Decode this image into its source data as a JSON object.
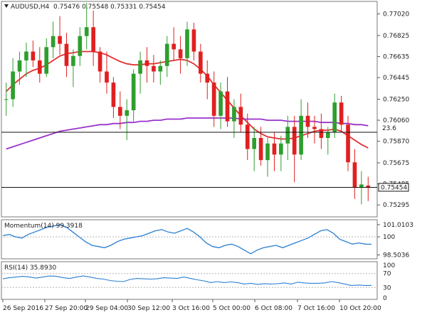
{
  "header": {
    "symbol": "AUDUSD,H4",
    "ohlc": "0.75476 0.75548 0.75331 0.75454"
  },
  "chart_data": [
    {
      "type": "candlestick",
      "title": "AUDUSD,H4",
      "price_labels": [
        "0.77020",
        "0.76825",
        "0.76635",
        "0.76445",
        "0.76250",
        "0.76060",
        "0.75870",
        "0.75675",
        "0.75485",
        "0.75295"
      ],
      "ylim": [
        0.752,
        0.7712
      ],
      "current_price": 0.75454,
      "current_price_label": "0.75454",
      "level_line": {
        "value": 0.75951,
        "label": "23.6"
      },
      "x_labels": [
        "26 Sep 2016",
        "27 Sep 20:00",
        "29 Sep 04:00",
        "30 Sep 12:00",
        "3 Oct 16:00",
        "5 Oct 00:00",
        "6 Oct 08:00",
        "7 Oct 16:00",
        "10 Oct 20:00"
      ],
      "candles": [
        [
          0.7625,
          0.764,
          0.761,
          0.7625
        ],
        [
          0.7625,
          0.7662,
          0.7618,
          0.765
        ],
        [
          0.765,
          0.7668,
          0.7638,
          0.766
        ],
        [
          0.766,
          0.7676,
          0.7645,
          0.7668
        ],
        [
          0.7668,
          0.7678,
          0.7654,
          0.766
        ],
        [
          0.766,
          0.7672,
          0.764,
          0.7648
        ],
        [
          0.7648,
          0.768,
          0.7645,
          0.7672
        ],
        [
          0.7672,
          0.7695,
          0.7662,
          0.7682
        ],
        [
          0.7682,
          0.77,
          0.7665,
          0.7675
        ],
        [
          0.7675,
          0.7685,
          0.7645,
          0.7655
        ],
        [
          0.7655,
          0.767,
          0.7636,
          0.7664
        ],
        [
          0.7664,
          0.769,
          0.7655,
          0.7682
        ],
        [
          0.7682,
          0.7712,
          0.767,
          0.769
        ],
        [
          0.769,
          0.7705,
          0.7655,
          0.7668
        ],
        [
          0.7668,
          0.7672,
          0.764,
          0.765
        ],
        [
          0.765,
          0.7668,
          0.763,
          0.764
        ],
        [
          0.764,
          0.7645,
          0.7608,
          0.7618
        ],
        [
          0.7618,
          0.7632,
          0.7598,
          0.761
        ],
        [
          0.761,
          0.7625,
          0.7588,
          0.7615
        ],
        [
          0.7615,
          0.7652,
          0.7605,
          0.7648
        ],
        [
          0.7648,
          0.7668,
          0.763,
          0.766
        ],
        [
          0.766,
          0.7672,
          0.764,
          0.7655
        ],
        [
          0.7655,
          0.7665,
          0.764,
          0.765
        ],
        [
          0.765,
          0.766,
          0.7638,
          0.7655
        ],
        [
          0.7655,
          0.7682,
          0.7645,
          0.7675
        ],
        [
          0.7675,
          0.769,
          0.766,
          0.767
        ],
        [
          0.767,
          0.7682,
          0.7648,
          0.7662
        ],
        [
          0.7662,
          0.7695,
          0.7655,
          0.7688
        ],
        [
          0.7688,
          0.7694,
          0.766,
          0.7668
        ],
        [
          0.7668,
          0.7675,
          0.764,
          0.7648
        ],
        [
          0.7648,
          0.766,
          0.7625,
          0.764
        ],
        [
          0.764,
          0.765,
          0.76,
          0.761
        ],
        [
          0.761,
          0.764,
          0.7598,
          0.7632
        ],
        [
          0.7632,
          0.7645,
          0.76,
          0.7605
        ],
        [
          0.7605,
          0.7625,
          0.759,
          0.7618
        ],
        [
          0.7618,
          0.763,
          0.7595,
          0.7602
        ],
        [
          0.7602,
          0.7612,
          0.757,
          0.758
        ],
        [
          0.758,
          0.76,
          0.756,
          0.759
        ],
        [
          0.759,
          0.76,
          0.7565,
          0.757
        ],
        [
          0.757,
          0.759,
          0.7555,
          0.7585
        ],
        [
          0.7585,
          0.7595,
          0.756,
          0.7575
        ],
        [
          0.7575,
          0.7592,
          0.756,
          0.7585
        ],
        [
          0.7585,
          0.761,
          0.757,
          0.76
        ],
        [
          0.76,
          0.761,
          0.755,
          0.7575
        ],
        [
          0.7575,
          0.7625,
          0.757,
          0.761
        ],
        [
          0.761,
          0.7622,
          0.759,
          0.76
        ],
        [
          0.76,
          0.761,
          0.7585,
          0.7598
        ],
        [
          0.7598,
          0.7612,
          0.758,
          0.759
        ],
        [
          0.759,
          0.76,
          0.7575,
          0.7595
        ],
        [
          0.7595,
          0.763,
          0.759,
          0.7622
        ],
        [
          0.7622,
          0.7628,
          0.7595,
          0.7602
        ],
        [
          0.7602,
          0.761,
          0.756,
          0.7568
        ],
        [
          0.7568,
          0.758,
          0.7535,
          0.7545
        ],
        [
          0.7545,
          0.756,
          0.753,
          0.7548
        ],
        [
          0.7547,
          0.7555,
          0.7533,
          0.7545
        ]
      ],
      "series": [
        {
          "name": "",
          "color": "#e03030",
          "values": [
            0.7632,
            0.7638,
            0.7643,
            0.7648,
            0.7651,
            0.7653,
            0.7656,
            0.766,
            0.7664,
            0.7666,
            0.7667,
            0.7668,
            0.7668,
            0.7668,
            0.7667,
            0.7665,
            0.7662,
            0.7659,
            0.7657,
            0.7656,
            0.7656,
            0.7657,
            0.7657,
            0.7658,
            0.7659,
            0.766,
            0.7661,
            0.766,
            0.7657,
            0.7652,
            0.7646,
            0.7638,
            0.7631,
            0.7624,
            0.7617,
            0.761,
            0.7604,
            0.7598,
            0.7594,
            0.7591,
            0.759,
            0.7589,
            0.7589,
            0.759,
            0.7592,
            0.7594,
            0.7596,
            0.7597,
            0.7597,
            0.7598,
            0.7596,
            0.7592,
            0.7588,
            0.7584,
            0.7581
          ]
        },
        {
          "name": "",
          "color": "#9933cc",
          "values": [
            0.758,
            0.7582,
            0.7584,
            0.7586,
            0.7588,
            0.759,
            0.7592,
            0.7594,
            0.7596,
            0.7597,
            0.7598,
            0.7599,
            0.76,
            0.7601,
            0.7602,
            0.7602,
            0.7603,
            0.7603,
            0.7604,
            0.7604,
            0.7605,
            0.7605,
            0.7606,
            0.7606,
            0.7607,
            0.7607,
            0.7607,
            0.7608,
            0.7608,
            0.7608,
            0.7608,
            0.7608,
            0.7608,
            0.7608,
            0.7608,
            0.7607,
            0.7607,
            0.7607,
            0.7607,
            0.7606,
            0.7606,
            0.7606,
            0.7605,
            0.7605,
            0.7605,
            0.7605,
            0.7605,
            0.7604,
            0.7604,
            0.7604,
            0.7603,
            0.7603,
            0.7602,
            0.7602,
            0.7601
          ]
        }
      ]
    },
    {
      "type": "line",
      "title": "Momentum(14) 99.3918",
      "y_labels": [
        "101.0103",
        "100",
        "98.5036"
      ],
      "ylim": [
        98.3,
        101.3
      ],
      "reference": 100,
      "series": [
        {
          "name": "Momentum(14)",
          "color": "#2a7fd4",
          "values": [
            100.1,
            100.2,
            100.0,
            99.9,
            100.2,
            100.4,
            100.6,
            100.8,
            100.9,
            101.0,
            100.8,
            100.4,
            100.0,
            99.6,
            99.3,
            99.2,
            99.1,
            99.3,
            99.6,
            99.8,
            99.9,
            100.0,
            100.1,
            100.3,
            100.5,
            100.6,
            100.4,
            100.3,
            100.5,
            100.7,
            100.4,
            100.0,
            99.5,
            99.2,
            99.1,
            99.3,
            99.4,
            99.2,
            98.9,
            98.6,
            98.9,
            99.1,
            99.2,
            99.3,
            99.1,
            99.3,
            99.5,
            99.7,
            99.9,
            100.2,
            100.5,
            100.6,
            100.3,
            99.8,
            99.6,
            99.4,
            99.5,
            99.4,
            99.39
          ]
        }
      ]
    },
    {
      "type": "line",
      "title": "RSI(14) 35.8930",
      "y_labels": [
        "100",
        "70",
        "30",
        "0"
      ],
      "ylim": [
        0,
        100
      ],
      "reference_levels": [
        30,
        70
      ],
      "series": [
        {
          "name": "RSI(14)",
          "color": "#2a7fd4",
          "values": [
            55,
            58,
            60,
            62,
            60,
            57,
            60,
            63,
            62,
            58,
            56,
            60,
            63,
            60,
            56,
            54,
            50,
            48,
            47,
            53,
            56,
            55,
            54,
            55,
            58,
            57,
            56,
            60,
            56,
            52,
            49,
            44,
            47,
            44,
            46,
            44,
            40,
            42,
            39,
            41,
            40,
            41,
            43,
            40,
            45,
            43,
            42,
            42,
            43,
            47,
            44,
            40,
            36,
            37,
            36,
            36
          ]
        }
      ]
    }
  ]
}
